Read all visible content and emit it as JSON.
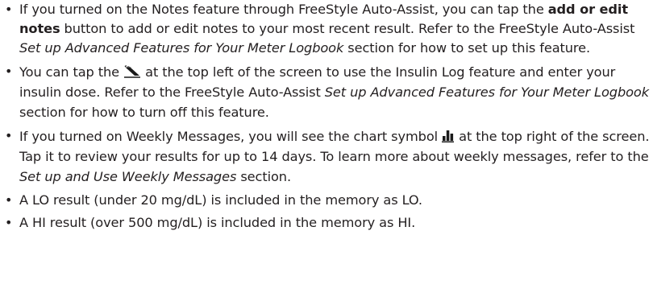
{
  "bullets": [
    {
      "parts": {
        "a": "If you turned on the Notes feature through FreeStyle Auto-Assist, you can tap the ",
        "b": "add or edit notes",
        "c": " button to add or edit notes to your most recent result. Refer to the FreeStyle Auto-Assist ",
        "d": "Set up Advanced Features for Your Meter Logbook",
        "e": " section for how to set up this feature."
      }
    },
    {
      "parts": {
        "a": "You can tap the ",
        "icon": "insulin-pen-icon",
        "b": " at the top left of the screen to use the Insulin Log feature and enter your insulin dose. Refer to the FreeStyle Auto-Assist ",
        "c": "Set up Advanced Features for Your Meter Logbook",
        "d": " section for how to turn off this feature."
      }
    },
    {
      "parts": {
        "a": "If you turned on Weekly Messages, you will see the chart symbol ",
        "icon": "bar-chart-icon",
        "b": " at the top right of the screen. Tap it to review your results for up to 14 days. To learn more about weekly messages, refer to the ",
        "c": "Set up and Use Weekly Messages",
        "d": " section."
      }
    },
    {
      "text": "A LO result (under 20 mg/dL) is included in the memory as LO."
    },
    {
      "text": "A HI result (over 500 mg/dL) is included in the memory as HI."
    }
  ],
  "bullet_glyph": "•",
  "colors": {
    "text": "#231f20",
    "icon": "#1a1a1a"
  }
}
